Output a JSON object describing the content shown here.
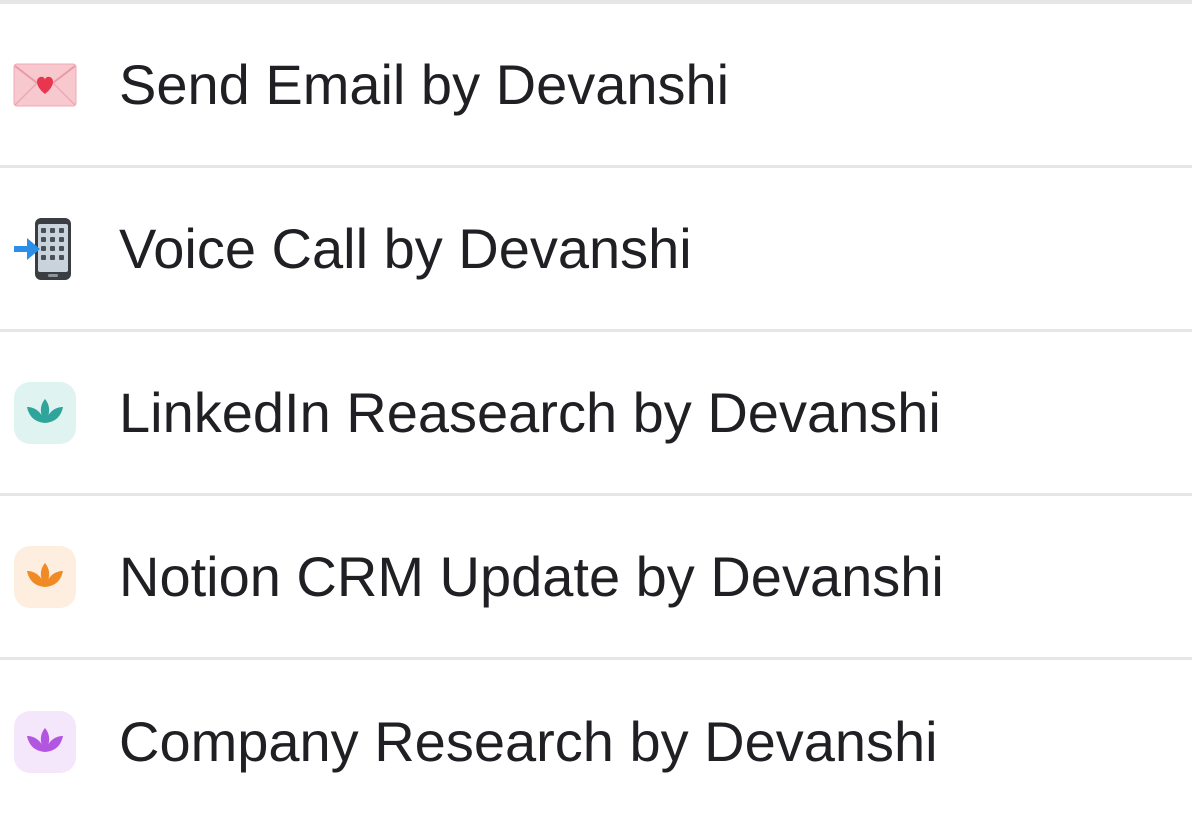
{
  "items": [
    {
      "label": "Send Email by Devanshi",
      "icon": "love-letter-icon"
    },
    {
      "label": "Voice Call by Devanshi",
      "icon": "mobile-phone-arrow-icon"
    },
    {
      "label": "LinkedIn Reasearch by Devanshi",
      "icon": "teal-lotus-icon",
      "tile_color": "#dff3f1",
      "icon_color": "#2fa49a"
    },
    {
      "label": "Notion CRM Update by Devanshi",
      "icon": "orange-lotus-icon",
      "tile_color": "#fdeee0",
      "icon_color": "#f08a24"
    },
    {
      "label": "Company Research by Devanshi",
      "icon": "purple-lotus-icon",
      "tile_color": "#f4e6fb",
      "icon_color": "#b255e0"
    }
  ],
  "colors": {
    "divider": "#e6e6e8",
    "text": "#1f1f24",
    "background": "#ffffff"
  }
}
